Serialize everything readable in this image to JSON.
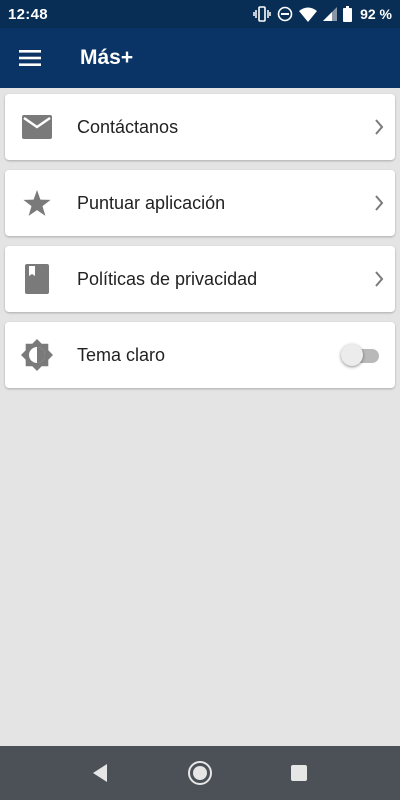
{
  "status_bar": {
    "time": "12:48",
    "battery": "92 %",
    "icons": [
      "vibrate-icon",
      "do-not-disturb-icon",
      "wifi-icon",
      "signal-icon",
      "battery-icon"
    ]
  },
  "app_bar": {
    "title": "Más+",
    "menu_icon": "hamburger-menu-icon",
    "background": "#0b3466"
  },
  "items": [
    {
      "label": "Contáctanos",
      "icon": "mail-icon",
      "control": "chevron"
    },
    {
      "label": "Puntuar aplicación",
      "icon": "star-icon",
      "control": "chevron"
    },
    {
      "label": "Políticas de privacidad",
      "icon": "book-icon",
      "control": "chevron"
    },
    {
      "label": "Tema claro",
      "icon": "brightness-icon",
      "control": "toggle",
      "toggle_on": false
    }
  ],
  "nav_bar": {
    "buttons": [
      "back-icon",
      "home-icon",
      "recents-icon"
    ]
  }
}
